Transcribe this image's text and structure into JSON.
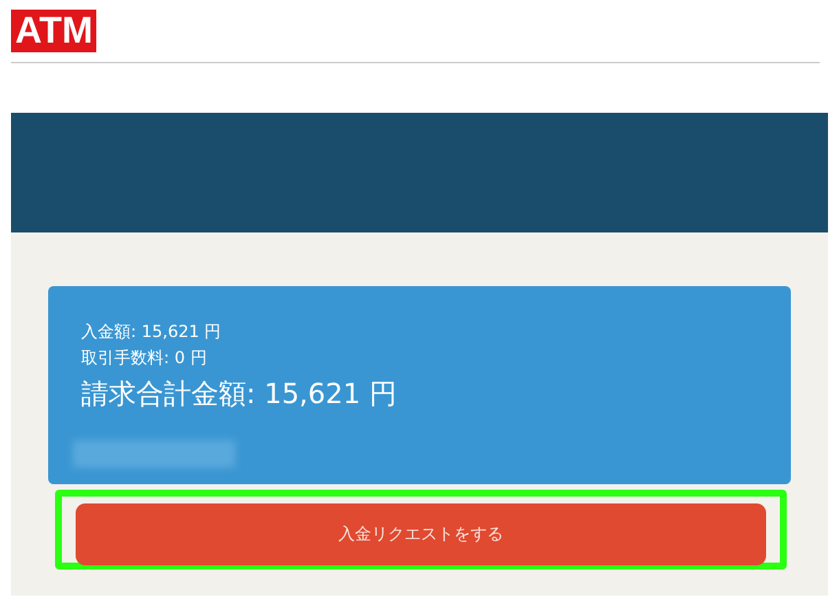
{
  "logo": {
    "text": "ATM"
  },
  "summary": {
    "lines": [
      {
        "kind": "small",
        "text": "入金額: 15,621 円"
      },
      {
        "kind": "small",
        "text": "取引手数料: 0 円"
      },
      {
        "kind": "large",
        "text": "請求合計金額: 15,621 円"
      }
    ],
    "redacted": true
  },
  "action": {
    "label": "入金リクエストをする",
    "highlighted": true
  }
}
